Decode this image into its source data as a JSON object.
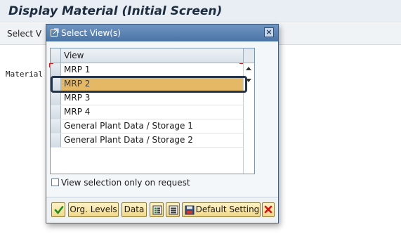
{
  "app": {
    "title": "Display Material (Initial Screen)",
    "toolbar_button": "Select V",
    "material_label": "Material"
  },
  "dialog": {
    "title": "Select View(s)",
    "close_symbol": "×",
    "table": {
      "header": "View",
      "rows": [
        {
          "label": "MRP 1",
          "selected": false
        },
        {
          "label": "MRP 2",
          "selected": true
        },
        {
          "label": "MRP 3",
          "selected": false
        },
        {
          "label": "MRP 4",
          "selected": false
        },
        {
          "label": "General Plant Data / Storage 1",
          "selected": false
        },
        {
          "label": "General Plant Data / Storage 2",
          "selected": false
        }
      ]
    },
    "checkbox": {
      "label": "View selection only on request",
      "checked": false
    },
    "footer": {
      "confirm_icon": "green-check-icon",
      "org_levels": "Org. Levels",
      "data": "Data",
      "select_all_icon": "select-all-icon",
      "deselect_all_icon": "deselect-all-icon",
      "save_icon": "save-icon",
      "default_setting": "Default Setting",
      "cancel_icon": "red-x-icon"
    }
  },
  "colors": {
    "selected_row": "#e5b866",
    "titlebar": "#4a74a6",
    "highlight_frame": "#23344b"
  }
}
